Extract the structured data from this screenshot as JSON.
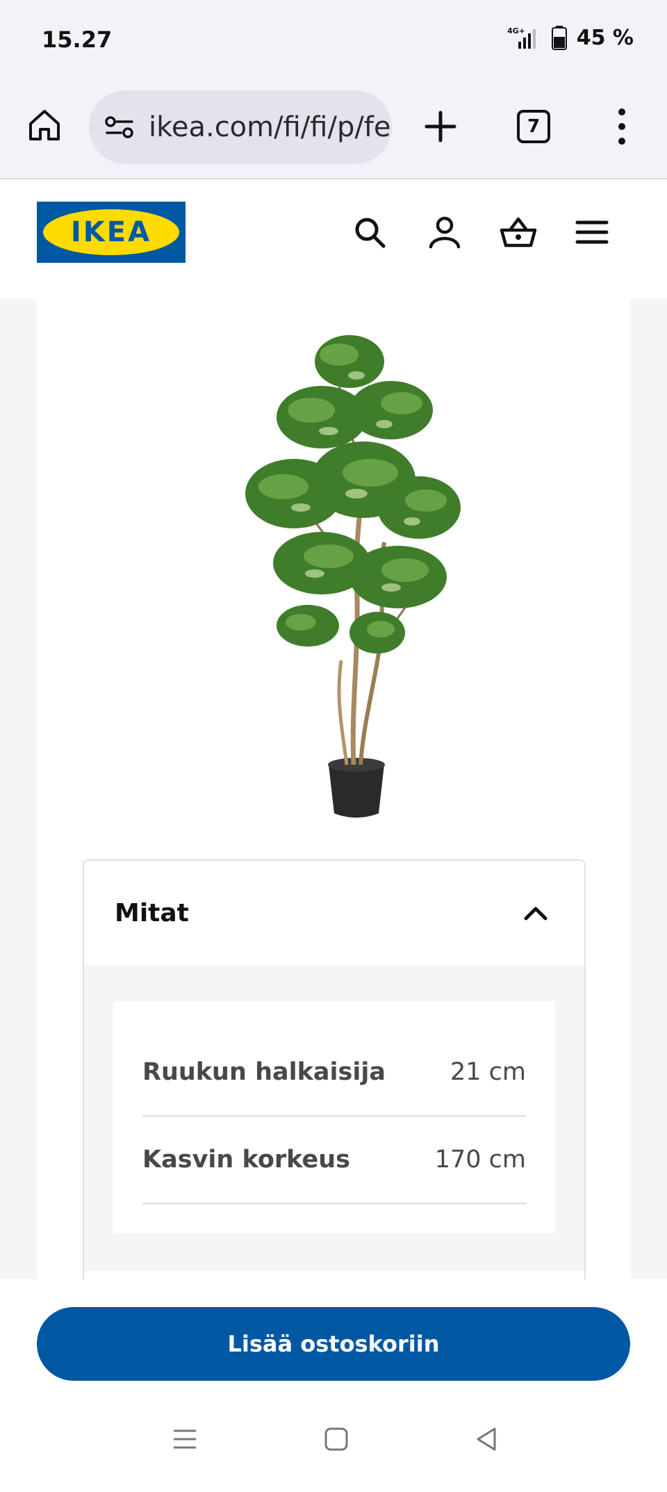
{
  "status_bar": {
    "time": "15.27",
    "network": "4G+",
    "battery": "45 %"
  },
  "browser": {
    "url": "ikea.com/fi/fi/p/fe",
    "tab_count": "7",
    "icons": [
      "home-icon",
      "site-settings-icon",
      "new-tab-icon",
      "tabs-icon",
      "more-menu-icon"
    ]
  },
  "site_header": {
    "logo_text": "IKEA",
    "icons": [
      "search-icon",
      "account-icon",
      "cart-icon",
      "hamburger-menu-icon"
    ]
  },
  "accordion": {
    "title": "Mitat",
    "expanded": true,
    "rows": [
      {
        "label": "Ruukun halkaisija",
        "value": "21 cm"
      },
      {
        "label": "Kasvin korkeus",
        "value": "170 cm"
      }
    ]
  },
  "cta": {
    "label": "Lisää ostoskoriin"
  },
  "colors": {
    "ikea_blue": "#0058a3",
    "ikea_yellow": "#ffdb00"
  }
}
